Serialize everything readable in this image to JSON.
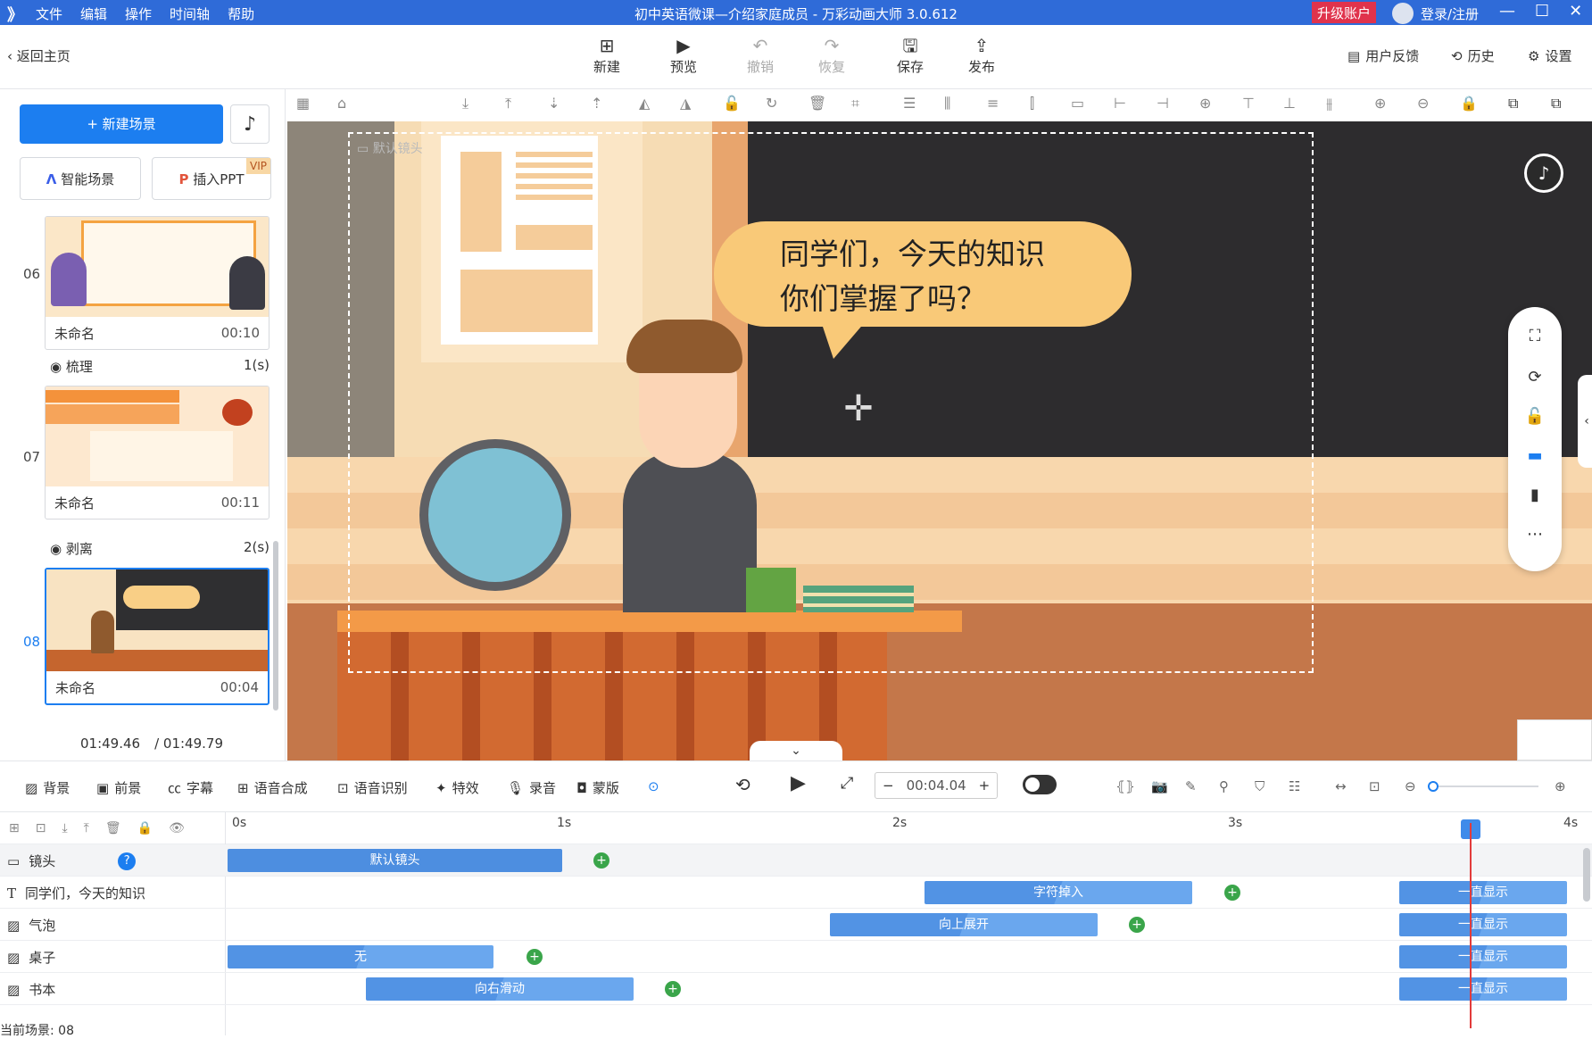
{
  "titlebar": {
    "logo": "》",
    "menus": [
      "文件",
      "编辑",
      "操作",
      "时间轴",
      "帮助"
    ],
    "title": "初中英语微课—介绍家庭成员 - 万彩动画大师 3.0.612",
    "upgrade": "升级账户",
    "login": "登录/注册",
    "min": "—",
    "max": "☐",
    "close": "✕"
  },
  "toolbar": {
    "back": "返回主页",
    "buttons": [
      {
        "label": "新建",
        "icon": "⊞"
      },
      {
        "label": "预览",
        "icon": "▶"
      },
      {
        "label": "撤销",
        "icon": "↶"
      },
      {
        "label": "恢复",
        "icon": "↷"
      },
      {
        "label": "保存",
        "icon": "🖫"
      },
      {
        "label": "发布",
        "icon": "⇪"
      }
    ],
    "feedback": "用户反馈",
    "history": "历史",
    "settings": "设置"
  },
  "left": {
    "new_scene": "+ 新建场景",
    "smart_scene": "智能场景",
    "insert_ppt": "插入PPT",
    "vip": "VIP",
    "scenes": [
      {
        "num": "06",
        "name": "未命名",
        "dur": "00:10"
      },
      {
        "num": "07",
        "name": "未命名",
        "dur": "00:11"
      },
      {
        "num": "08",
        "name": "未命名",
        "dur": "00:04"
      }
    ],
    "transitions": [
      {
        "name": "梳理",
        "dur": "1(s)"
      },
      {
        "name": "剥离",
        "dur": "2(s)"
      }
    ],
    "time_current": "01:49.46",
    "time_total": "/ 01:49.79"
  },
  "canvas": {
    "camera_label": "默认镜头",
    "bubble_line1": "同学们，今天的知识",
    "bubble_line2": "你们掌握了吗？"
  },
  "bottombar": {
    "items": [
      "背景",
      "前景",
      "字幕",
      "语音合成",
      "语音识别",
      "特效",
      "录音",
      "蒙版"
    ],
    "time": "00:04.04",
    "minus": "−",
    "plus": "+"
  },
  "timeline": {
    "ruler": [
      "0s",
      "1s",
      "2s",
      "3s",
      "4s"
    ],
    "tracks": [
      {
        "name": "镜头",
        "clips": [
          {
            "label": "默认镜头"
          }
        ]
      },
      {
        "name": "同学们，今天的知识",
        "clips": [
          {
            "label": "字符掉入"
          },
          {
            "label": "一直显示"
          }
        ]
      },
      {
        "name": "气泡",
        "clips": [
          {
            "label": "向上展开"
          },
          {
            "label": "一直显示"
          }
        ]
      },
      {
        "name": "桌子",
        "clips": [
          {
            "label": "无"
          },
          {
            "label": "一直显示"
          }
        ]
      },
      {
        "name": "书本",
        "clips": [
          {
            "label": "向右滑动"
          },
          {
            "label": "一直显示"
          }
        ]
      }
    ],
    "status": "当前场景: 08"
  }
}
